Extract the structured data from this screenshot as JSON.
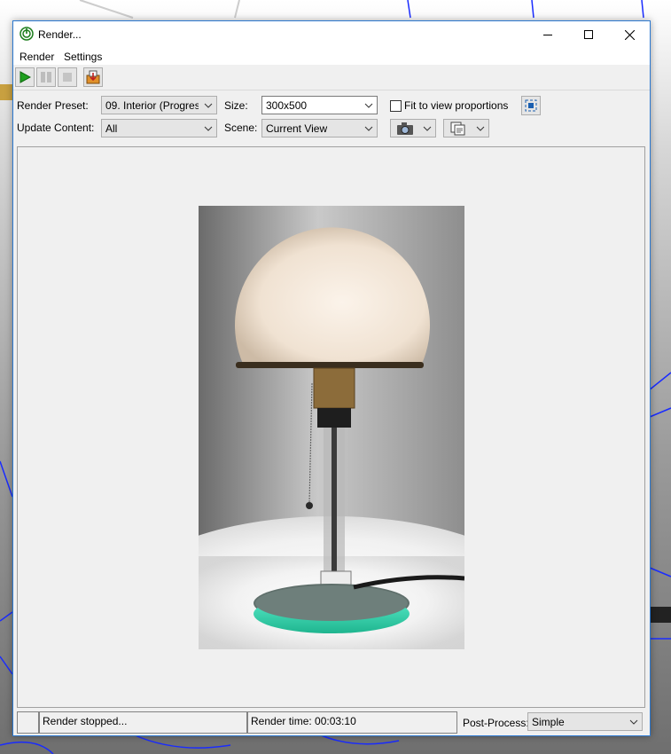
{
  "window": {
    "title": "Render..."
  },
  "menu": [
    "Render",
    "Settings"
  ],
  "toolbar": {
    "buttons": [
      "play-icon",
      "pause-icon",
      "stop-icon",
      "save-render-icon"
    ]
  },
  "settings": {
    "render_preset_label": "Render Preset:",
    "render_preset_value": "09. Interior (Progress",
    "size_label": "Size:",
    "size_value": "300x500",
    "fit_label": "Fit to view proportions",
    "update_content_label": "Update Content:",
    "update_content_value": "All",
    "scene_label": "Scene:",
    "scene_value": "Current View"
  },
  "status": {
    "message": "Render stopped...",
    "render_time": "Render time: 00:03:10",
    "post_process_label": "Post-Process:",
    "post_process_value": "Simple"
  },
  "colors": {
    "accent": "#2b78d0",
    "play_green": "#1fa01f",
    "lamp_glow": "#efe2d2",
    "base_teal": "#3ad6b4"
  }
}
